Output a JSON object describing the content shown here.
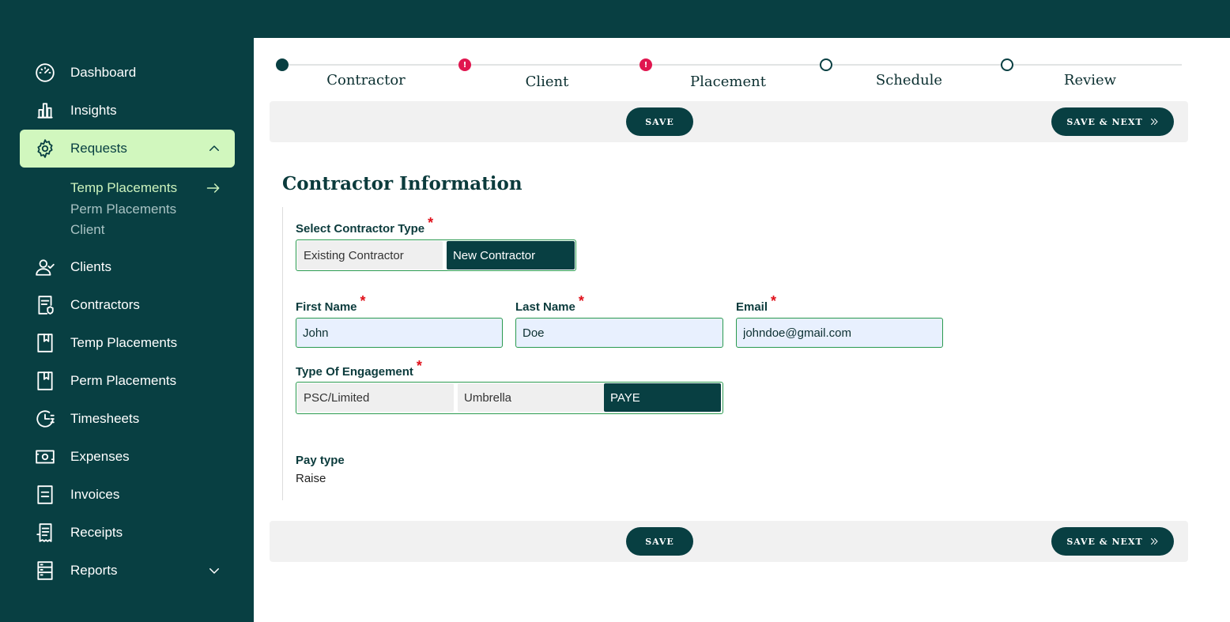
{
  "sidebar": {
    "items": [
      {
        "label": "Dashboard",
        "icon": "gauge-icon"
      },
      {
        "label": "Insights",
        "icon": "bar-chart-icon"
      },
      {
        "label": "Requests",
        "icon": "gear-icon"
      },
      {
        "label": "Clients",
        "icon": "user-check-icon"
      },
      {
        "label": "Contractors",
        "icon": "document-shield-icon"
      },
      {
        "label": "Temp Placements",
        "icon": "bookmark-page-icon"
      },
      {
        "label": "Perm Placements",
        "icon": "bookmark-page-icon"
      },
      {
        "label": "Timesheets",
        "icon": "clock-icon"
      },
      {
        "label": "Expenses",
        "icon": "cash-icon"
      },
      {
        "label": "Invoices",
        "icon": "invoice-icon"
      },
      {
        "label": "Receipts",
        "icon": "receipt-icon"
      },
      {
        "label": "Reports",
        "icon": "server-list-icon"
      }
    ],
    "requests_sub": [
      {
        "label": "Temp Placements"
      },
      {
        "label": "Perm Placements"
      },
      {
        "label": "Client"
      }
    ]
  },
  "stepper": {
    "steps": [
      {
        "label": "Contractor",
        "status": "done"
      },
      {
        "label": "Client",
        "status": "error"
      },
      {
        "label": "Placement",
        "status": "error"
      },
      {
        "label": "Schedule",
        "status": "todo"
      },
      {
        "label": "Review",
        "status": "todo"
      }
    ],
    "error_mark": "!"
  },
  "actions": {
    "save_label": "SAVE",
    "save_next_label": "SAVE & NEXT"
  },
  "form": {
    "title": "Contractor Information",
    "required_mark": "*",
    "contractor_type": {
      "label": "Select Contractor Type",
      "options": [
        "Existing Contractor",
        "New Contractor"
      ],
      "selected": "New Contractor"
    },
    "first_name": {
      "label": "First Name",
      "value": "John"
    },
    "last_name": {
      "label": "Last Name",
      "value": "Doe"
    },
    "email": {
      "label": "Email",
      "value": "johndoe@gmail.com"
    },
    "engagement": {
      "label": "Type Of Engagement",
      "options": [
        "PSC/Limited",
        "Umbrella",
        "PAYE"
      ],
      "selected": "PAYE"
    },
    "pay_type": {
      "label": "Pay type",
      "value": "Raise"
    }
  },
  "colors": {
    "brand_dark": "#083f42",
    "active_nav": "#d1f7be",
    "error": "#e0164f",
    "input_border": "#2a9a4f"
  }
}
